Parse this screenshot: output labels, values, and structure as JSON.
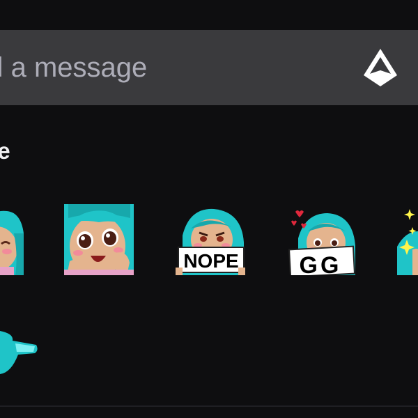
{
  "chat": {
    "input_placeholder": "nd a message",
    "bits_icon": "bits-icon"
  },
  "emote_section": {
    "title": "ae",
    "emotes": [
      {
        "icon": "blushing-girl-emote"
      },
      {
        "icon": "shocked-girl-emote"
      },
      {
        "icon": "nope-sign-emote",
        "sign_text": "NOPE"
      },
      {
        "icon": "gg-sign-emote",
        "sign_text": "GG"
      },
      {
        "icon": "sparkle-girl-emote"
      }
    ],
    "next_row_partial": {
      "icon": "cyan-blob-emote"
    }
  },
  "colors": {
    "background": "#0e0e10",
    "input_bar": "#3a3a3d",
    "placeholder_text": "#adadb8",
    "title_text": "#efeff1",
    "hair": "#1fc4c8",
    "skin": "#e4b48e"
  }
}
